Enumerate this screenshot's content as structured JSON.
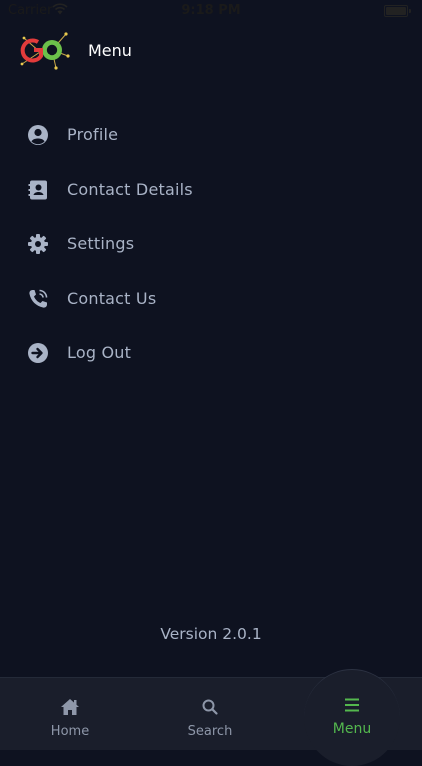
{
  "status_bar": {
    "carrier": "Carrier",
    "time": "9:18 PM"
  },
  "header": {
    "title": "Menu",
    "logo_text": "GO"
  },
  "menu": {
    "items": [
      {
        "label": "Profile",
        "icon": "profile-icon"
      },
      {
        "label": "Contact Details",
        "icon": "contact-card-icon"
      },
      {
        "label": "Settings",
        "icon": "gear-icon"
      },
      {
        "label": "Contact Us",
        "icon": "phone-icon"
      },
      {
        "label": "Log Out",
        "icon": "logout-icon"
      }
    ]
  },
  "footer": {
    "version": "Version 2.0.1"
  },
  "tabbar": {
    "tabs": [
      {
        "label": "Home",
        "icon": "home-icon",
        "active": false
      },
      {
        "label": "Search",
        "icon": "search-icon",
        "active": false
      },
      {
        "label": "Menu",
        "icon": "menu-icon",
        "active": true
      }
    ]
  },
  "colors": {
    "background": "#0e1220",
    "text": "#a9b3c6",
    "tabbar": "#1a1e2b",
    "accent": "#54b84e",
    "logo_red": "#e23b3b",
    "logo_green": "#6cc04a"
  }
}
